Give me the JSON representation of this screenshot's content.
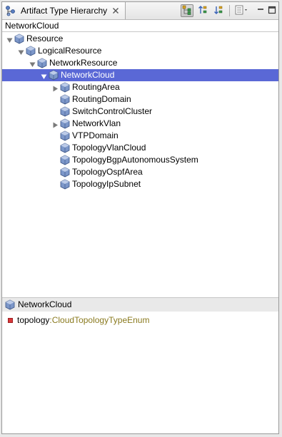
{
  "view": {
    "tab_title": "Artifact Type Hierarchy",
    "path_label": "NetworkCloud"
  },
  "toolbar": {
    "buttons": [
      "type-hierarchy-icon",
      "supertype-hierarchy-icon",
      "subtype-hierarchy-icon",
      "view-menu-icon"
    ]
  },
  "tree": {
    "nodes": [
      {
        "label": "Resource",
        "depth": 0,
        "expanded": true
      },
      {
        "label": "LogicalResource",
        "depth": 1,
        "expanded": true
      },
      {
        "label": "NetworkResource",
        "depth": 2,
        "expanded": true
      },
      {
        "label": "NetworkCloud",
        "depth": 3,
        "expanded": true,
        "selected": true
      },
      {
        "label": "RoutingArea",
        "depth": 4,
        "expandable": true
      },
      {
        "label": "RoutingDomain",
        "depth": 4
      },
      {
        "label": "SwitchControlCluster",
        "depth": 4
      },
      {
        "label": "NetworkVlan",
        "depth": 4,
        "expandable": true
      },
      {
        "label": "VTPDomain",
        "depth": 4
      },
      {
        "label": "TopologyVlanCloud",
        "depth": 4
      },
      {
        "label": "TopologyBgpAutonomousSystem",
        "depth": 4
      },
      {
        "label": "TopologyOspfArea",
        "depth": 4
      },
      {
        "label": "TopologyIpSubnet",
        "depth": 4
      }
    ]
  },
  "details": {
    "title": "NetworkCloud",
    "attribute": {
      "name": "topology",
      "separator": " : ",
      "type": "CloudTopologyTypeEnum"
    }
  },
  "colors": {
    "selection": "#5a68d6",
    "attr_type": "#8a7a1f",
    "attr_icon": "#d9383a"
  }
}
